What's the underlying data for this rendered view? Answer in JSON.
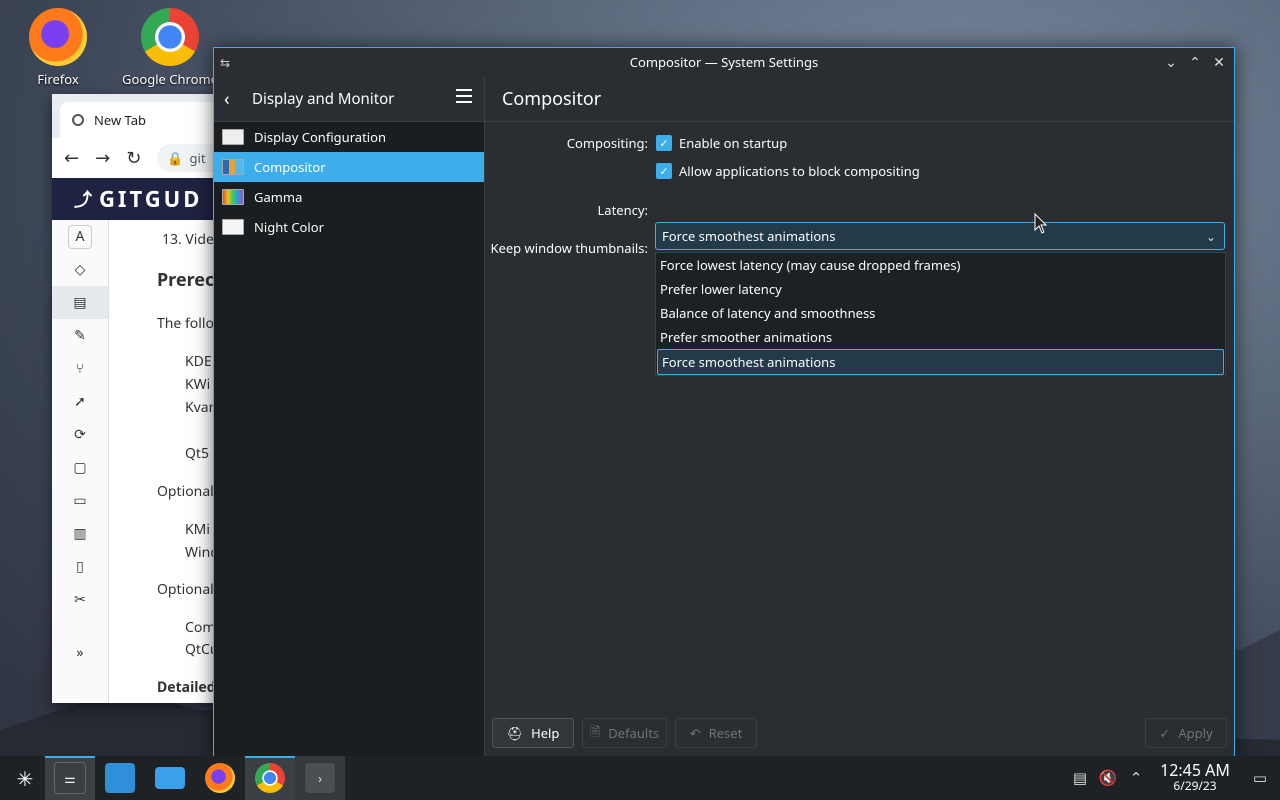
{
  "desktop": {
    "icons": [
      {
        "label": "Firefox"
      },
      {
        "label": "Google Chrome"
      }
    ]
  },
  "browser": {
    "tab_title": "New Tab",
    "url_fragment": "git",
    "banner_text": "GITGUD",
    "content_lines": [
      "13. Vide",
      "Prerec",
      "The follo",
      "KDE",
      "KWi",
      "Kvar",
      "Qt5",
      "Optional",
      "KMi",
      "Wind",
      "Optional",
      "Com",
      "QtCu",
      "Detailed"
    ]
  },
  "window": {
    "title": "Compositor — System Settings",
    "sidebar_title": "Display and Monitor",
    "nav_items": [
      {
        "label": "Display Configuration"
      },
      {
        "label": "Compositor"
      },
      {
        "label": "Gamma"
      },
      {
        "label": "Night Color"
      }
    ],
    "page_title": "Compositor",
    "compositing_label": "Compositing:",
    "enable_on_startup": "Enable on startup",
    "allow_block": "Allow applications to block compositing",
    "latency_label": "Latency:",
    "latency_value": "Force smoothest animations",
    "thumbnails_label": "Keep window thumbnails:",
    "latency_options": [
      "Force lowest latency (may cause dropped frames)",
      "Prefer lower latency",
      "Balance of latency and smoothness",
      "Prefer smoother animations",
      "Force smoothest animations"
    ],
    "buttons": {
      "help": "Help",
      "defaults": "Defaults",
      "reset": "Reset",
      "apply": "Apply"
    }
  },
  "taskbar": {
    "time": "12:45 AM",
    "date": "6/29/23"
  },
  "colors": {
    "accent": "#3daee9",
    "window_bg": "#2a2e32",
    "sidebar_bg": "#1b1e20"
  }
}
